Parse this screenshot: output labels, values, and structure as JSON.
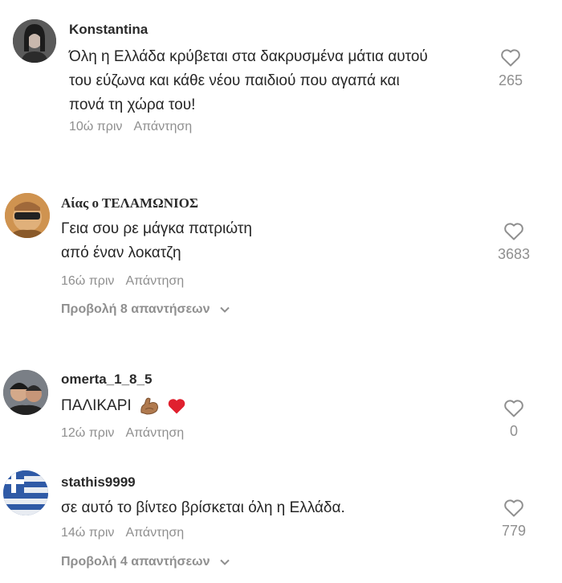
{
  "comments": [
    {
      "username": "Konstantina",
      "lines": [
        "Όλη η Ελλάδα κρύβεται στα δακρυσμένα μάτια αυτού",
        "του εύζωνα και κάθε νέου παιδιού που αγαπά και",
        "πονά τη χώρα του!"
      ],
      "time": "10ώ πριν",
      "reply_label": "Απάντηση",
      "likes": "265"
    },
    {
      "username": "Αίας ο ΤΕΛΑΜΩΝΙΟΣ",
      "lines": [
        "Γεια σου ρε μάγκα πατριώτη",
        "από έναν λοκατζη"
      ],
      "time": "16ώ πριν",
      "reply_label": "Απάντηση",
      "likes": "3683",
      "view_replies": "Προβολή 8 απαντήσεων"
    },
    {
      "username": "omerta_1_8_5",
      "lines": [
        "ΠΑΛΙΚΑΡΙ"
      ],
      "time": "12ώ πριν",
      "reply_label": "Απάντηση",
      "likes": "0",
      "emojis": [
        "flexed-biceps-icon",
        "red-heart-icon"
      ]
    },
    {
      "username": "stathis9999",
      "lines": [
        "σε αυτό το βίντεο βρίσκεται όλη η Ελλάδα."
      ],
      "time": "14ώ πριν",
      "reply_label": "Απάντηση",
      "likes": "779",
      "view_replies": "Προβολή 4 απαντήσεων"
    }
  ],
  "colors": {
    "secondary_text": "#8f8f8f",
    "heart_emoji": "#e0202e"
  }
}
